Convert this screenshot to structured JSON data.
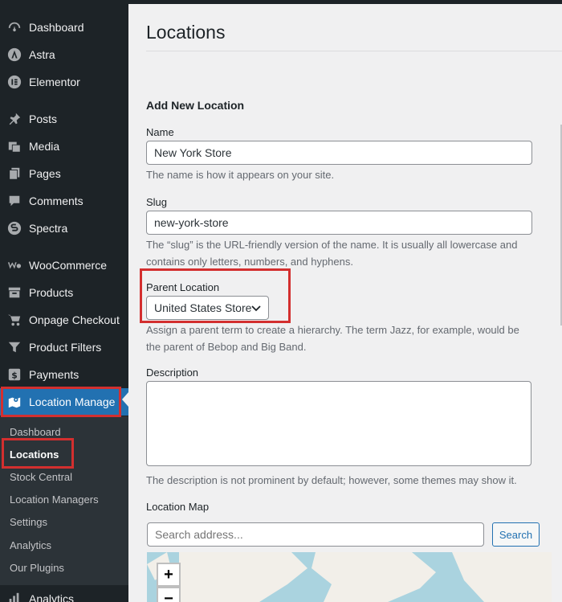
{
  "sidebar": {
    "items": [
      {
        "label": "Dashboard",
        "icon": "dashboard-icon"
      },
      {
        "label": "Astra",
        "icon": "astra-icon"
      },
      {
        "label": "Elementor",
        "icon": "elementor-icon"
      },
      {
        "label": "Posts",
        "icon": "pushpin-icon"
      },
      {
        "label": "Media",
        "icon": "media-icon"
      },
      {
        "label": "Pages",
        "icon": "pages-icon"
      },
      {
        "label": "Comments",
        "icon": "comment-icon"
      },
      {
        "label": "Spectra",
        "icon": "spectra-icon"
      },
      {
        "label": "WooCommerce",
        "icon": "woocommerce-icon"
      },
      {
        "label": "Products",
        "icon": "archive-icon"
      },
      {
        "label": "Onpage Checkout",
        "icon": "cart-icon"
      },
      {
        "label": "Product Filters",
        "icon": "filter-icon"
      },
      {
        "label": "Payments",
        "icon": "dollar-icon"
      },
      {
        "label": "Location Manage",
        "icon": "map-icon"
      }
    ],
    "submenu": [
      "Dashboard",
      "Locations",
      "Stock Central",
      "Location Managers",
      "Settings",
      "Analytics",
      "Our Plugins"
    ],
    "bottom_item": {
      "label": "Analytics",
      "icon": "chart-icon"
    }
  },
  "page": {
    "title": "Locations",
    "form_heading": "Add New Location",
    "name": {
      "label": "Name",
      "value": "New York Store",
      "help": "The name is how it appears on your site."
    },
    "slug": {
      "label": "Slug",
      "value": "new-york-store",
      "help1": "The “slug” is the URL-friendly version of the name. It is usually all lowercase and",
      "help2": "contains only letters, numbers, and hyphens."
    },
    "parent": {
      "label": "Parent Location",
      "selected": "United States Store",
      "help1": "Assign a parent term to create a hierarchy. The term Jazz, for example, would be",
      "help2": "the parent of Bebop and Big Band."
    },
    "description": {
      "label": "Description",
      "value": "",
      "help": "The description is not prominent by default; however, some themes may show it."
    },
    "map": {
      "label": "Location Map",
      "search_placeholder": "Search address...",
      "search_button": "Search",
      "zoom_in": "+",
      "zoom_out": "−"
    }
  },
  "colors": {
    "accent": "#2271b1",
    "highlight": "#d32f2f",
    "sidebar_bg": "#1d2327"
  }
}
